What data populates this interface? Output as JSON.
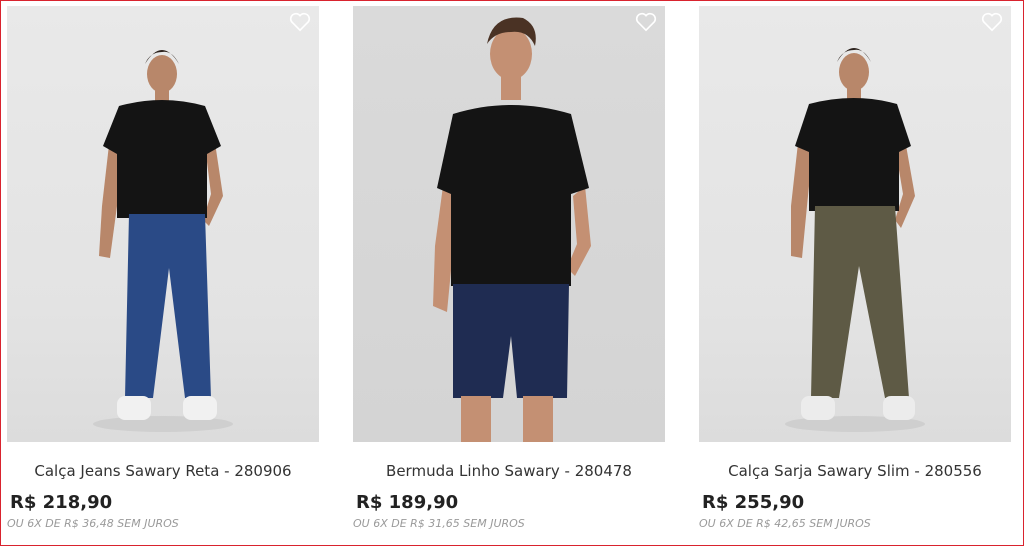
{
  "products": [
    {
      "name": "Calça Jeans Sawary Reta - 280906",
      "price": "R$ 218,90",
      "installments": "OU 6X DE R$ 36,48 SEM JUROS",
      "pants_color": "#2a4a86"
    },
    {
      "name": "Bermuda Linho Sawary - 280478",
      "price": "R$ 189,90",
      "installments": "OU 6X DE R$ 31,65 SEM JUROS",
      "pants_color": "#1f2c52"
    },
    {
      "name": "Calça Sarja Sawary Slim - 280556",
      "price": "R$ 255,90",
      "installments": "OU 6X DE R$ 42,65 SEM JUROS",
      "pants_color": "#5e5a45"
    }
  ],
  "icons": {
    "favorite": "heart-outline-icon"
  },
  "colors": {
    "border": "#d9232e",
    "shirt": "#141414"
  }
}
